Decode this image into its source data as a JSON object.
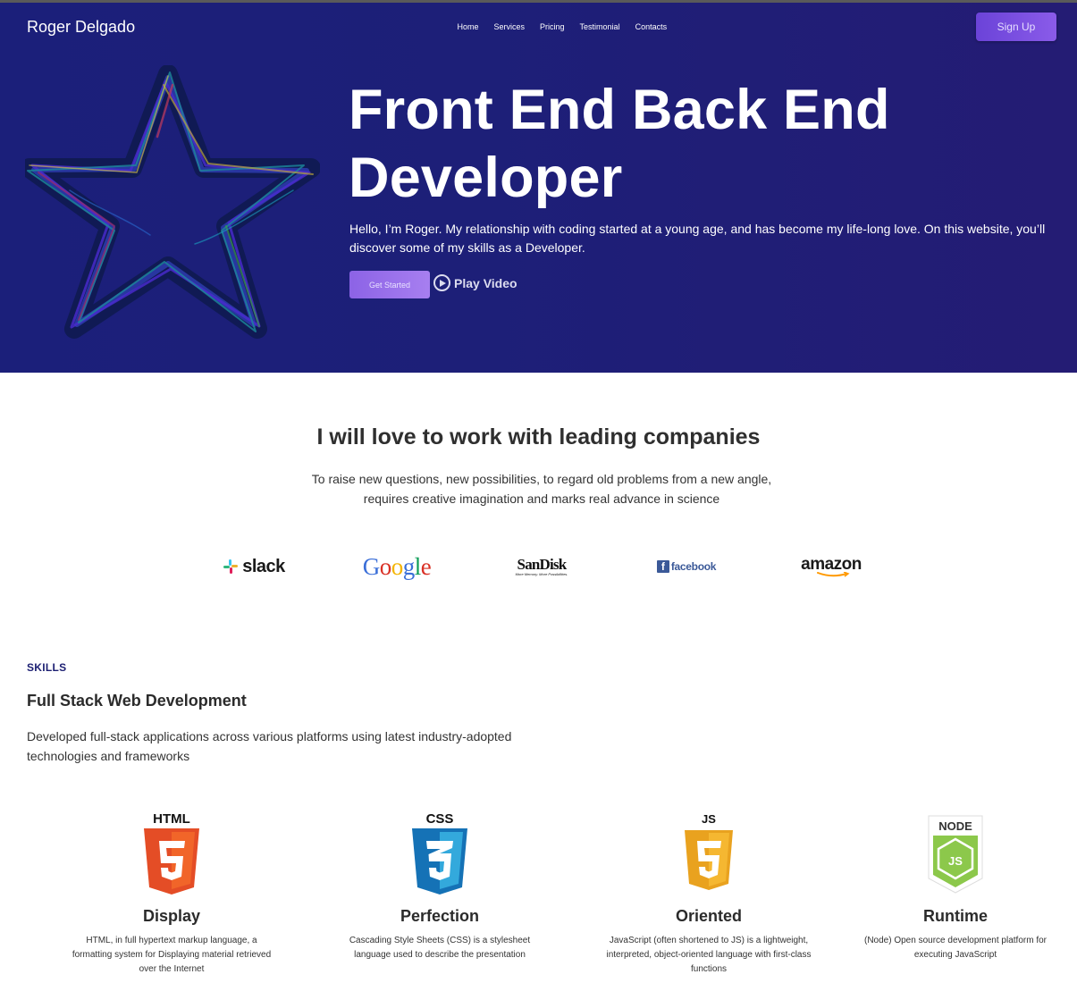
{
  "header": {
    "brand": "Roger Delgado",
    "nav": [
      "Home",
      "Services",
      "Pricing",
      "Testimonial",
      "Contacts"
    ],
    "signup_label": "Sign Up"
  },
  "hero": {
    "title_line1": "Front End Back End",
    "title_line2": "Developer",
    "text": "Hello, I’m Roger. My relationship with coding started at a young age, and has become my life-long love. On this website, you’ll discover some of my skills as a Developer.",
    "cta_label": "Get Started",
    "play_label": "Play Video",
    "play_icon": "play-circle-icon"
  },
  "companies": {
    "title": "I will love to work with leading companies",
    "text": "To raise new questions, new possibilities, to regard old problems from a new angle, requires creative imagination and marks real advance in science",
    "logos": [
      {
        "name": "slack",
        "text": "slack"
      },
      {
        "name": "google",
        "text": "Google"
      },
      {
        "name": "sandisk",
        "text": "SanDisk",
        "tagline": "More Memory. More Possibilities."
      },
      {
        "name": "facebook",
        "text": "facebook"
      },
      {
        "name": "amazon",
        "text": "amazon"
      }
    ]
  },
  "skills": {
    "kicker": "SKILLS",
    "title": "Full Stack Web Development",
    "text": "Developed full-stack applications across various platforms using latest industry-adopted technologies and frameworks",
    "items": [
      {
        "icon": "html5-icon",
        "badge": "HTML",
        "glyph": "5",
        "name": "Display",
        "desc": "HTML, in full hypertext markup language, a formatting system for Displaying material retrieved over the Internet"
      },
      {
        "icon": "css3-icon",
        "badge": "CSS",
        "glyph": "3",
        "name": "Perfection",
        "desc": "Cascading Style Sheets (CSS) is a stylesheet language used to describe the presentation"
      },
      {
        "icon": "js-icon",
        "badge": "JS",
        "glyph": "5",
        "name": "Oriented",
        "desc": "JavaScript (often shortened to JS) is a lightweight, interpreted, object-oriented language with first-class functions"
      },
      {
        "icon": "nodejs-icon",
        "badge": "NODE",
        "glyph": "JS",
        "name": "Runtime",
        "desc": "(Node) Open source development platform for executing JavaScript"
      }
    ]
  },
  "colors": {
    "hero_bg": "#1d1f78",
    "accent": "#7b4fe0",
    "kicker": "#1c1f72",
    "html": "#e44d26",
    "css": "#1572b6",
    "js": "#f0a323",
    "node": "#8cc84b"
  }
}
